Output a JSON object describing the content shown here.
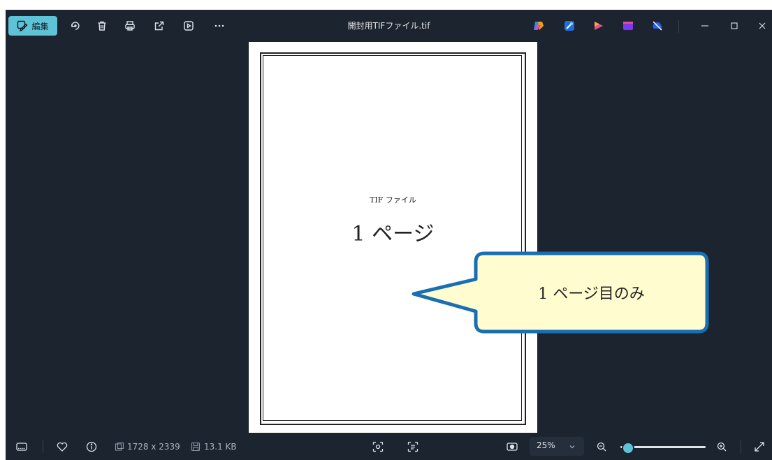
{
  "toolbar": {
    "edit_label": "編集"
  },
  "window": {
    "title": "開封用TIFファイル.tif"
  },
  "document": {
    "label": "TIF ファイル",
    "heading": "1 ページ"
  },
  "callout": {
    "text": "1 ページ目のみ"
  },
  "status": {
    "dimensions": "1728 x 2339",
    "file_size": "13.1 KB",
    "zoom_level": "25%",
    "zoom_slider_fraction": 0.02
  },
  "colors": {
    "accent": "#5ec3d6",
    "background": "#1c2430",
    "callout_fill": "#fffdcf",
    "callout_border": "#1a6fb3"
  }
}
